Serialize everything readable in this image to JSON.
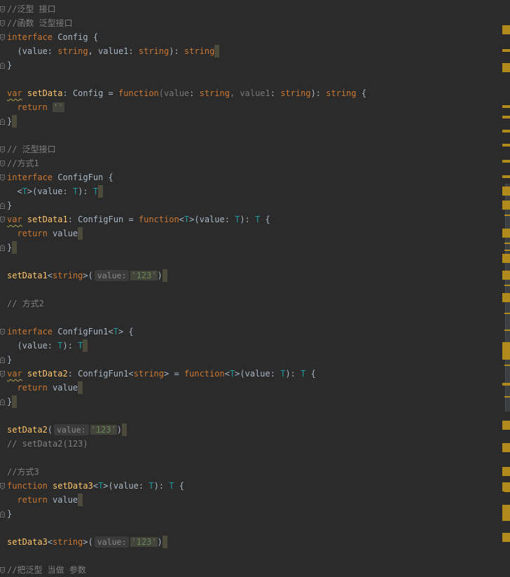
{
  "colors": {
    "background": "#2b2b2b",
    "comment": "#808080",
    "keyword": "#cc7832",
    "function_name": "#ffc66d",
    "string": "#6a8759",
    "type_param": "#20999d",
    "text": "#a9b7c6",
    "marker": "#b08a1a"
  },
  "lines": [
    {
      "fold": "open",
      "tokens": [
        [
          "c",
          "//泛型 接口"
        ]
      ]
    },
    {
      "fold": "open",
      "tokens": [
        [
          "c",
          "//函数 泛型接口"
        ]
      ]
    },
    {
      "fold": "open",
      "tokens": [
        [
          "k",
          "interface"
        ],
        [
          "p",
          " Config {"
        ]
      ]
    },
    {
      "fold": "",
      "tokens": [
        [
          "p",
          "  (value: "
        ],
        [
          "k",
          "string"
        ],
        [
          "p",
          ", value1: "
        ],
        [
          "k",
          "string"
        ],
        [
          "p",
          "): "
        ],
        [
          "k",
          "string"
        ],
        [
          "caret",
          ""
        ]
      ]
    },
    {
      "fold": "close",
      "tokens": [
        [
          "p",
          "}"
        ]
      ]
    },
    {
      "fold": "",
      "tokens": []
    },
    {
      "fold": "",
      "tokens": [
        [
          "ksq",
          "var"
        ],
        [
          "p",
          " "
        ],
        [
          "f",
          "setData"
        ],
        [
          "p",
          ": Config = "
        ],
        [
          "k",
          "function"
        ],
        [
          "d",
          "("
        ],
        [
          "d",
          "value"
        ],
        [
          "p",
          ": "
        ],
        [
          "k",
          "string"
        ],
        [
          "d",
          ", value1"
        ],
        [
          "p",
          ": "
        ],
        [
          "k",
          "string"
        ],
        [
          "p",
          "): "
        ],
        [
          "k",
          "string"
        ],
        [
          "p",
          " {"
        ]
      ]
    },
    {
      "fold": "",
      "tokens": [
        [
          "p",
          "  "
        ],
        [
          "k",
          "return"
        ],
        [
          "p",
          " "
        ],
        [
          "shl",
          "''"
        ]
      ]
    },
    {
      "fold": "close",
      "tokens": [
        [
          "p",
          "}"
        ],
        [
          "caret",
          ""
        ]
      ]
    },
    {
      "fold": "",
      "tokens": []
    },
    {
      "fold": "open",
      "tokens": [
        [
          "c",
          "// 泛型接口"
        ]
      ]
    },
    {
      "fold": "open",
      "tokens": [
        [
          "c",
          "//方式1"
        ]
      ]
    },
    {
      "fold": "open",
      "tokens": [
        [
          "k",
          "interface"
        ],
        [
          "p",
          " ConfigFun {"
        ]
      ]
    },
    {
      "fold": "",
      "tokens": [
        [
          "p",
          "  <"
        ],
        [
          "t",
          "T"
        ],
        [
          "p",
          ">(value: "
        ],
        [
          "t",
          "T"
        ],
        [
          "p",
          "): "
        ],
        [
          "t",
          "T"
        ],
        [
          "caret",
          ""
        ]
      ]
    },
    {
      "fold": "close",
      "tokens": [
        [
          "p",
          "}"
        ]
      ]
    },
    {
      "fold": "open",
      "tokens": [
        [
          "ksq",
          "var"
        ],
        [
          "p",
          " "
        ],
        [
          "f",
          "setData1"
        ],
        [
          "p",
          ": ConfigFun = "
        ],
        [
          "k",
          "function"
        ],
        [
          "p",
          "<"
        ],
        [
          "t",
          "T"
        ],
        [
          "p",
          ">(value: "
        ],
        [
          "t",
          "T"
        ],
        [
          "p",
          "): "
        ],
        [
          "t",
          "T"
        ],
        [
          "p",
          " {"
        ]
      ]
    },
    {
      "fold": "",
      "tokens": [
        [
          "p",
          "  "
        ],
        [
          "k",
          "return"
        ],
        [
          "p",
          " value"
        ],
        [
          "caret",
          ""
        ]
      ]
    },
    {
      "fold": "close",
      "tokens": [
        [
          "p",
          "}"
        ],
        [
          "caret",
          ""
        ]
      ]
    },
    {
      "fold": "",
      "tokens": []
    },
    {
      "fold": "",
      "tokens": [
        [
          "f",
          "setData1"
        ],
        [
          "p",
          "<"
        ],
        [
          "k",
          "string"
        ],
        [
          "p",
          ">("
        ],
        [
          "hint",
          "value:"
        ],
        [
          "shl",
          "'123'"
        ],
        [
          "p",
          ")"
        ],
        [
          "caret",
          ""
        ]
      ]
    },
    {
      "fold": "",
      "tokens": []
    },
    {
      "fold": "",
      "tokens": [
        [
          "c",
          "// 方式2"
        ]
      ]
    },
    {
      "fold": "",
      "tokens": []
    },
    {
      "fold": "open",
      "tokens": [
        [
          "k",
          "interface"
        ],
        [
          "p",
          " ConfigFun1<"
        ],
        [
          "t",
          "T"
        ],
        [
          "p",
          "> {"
        ]
      ]
    },
    {
      "fold": "",
      "tokens": [
        [
          "p",
          "  (value: "
        ],
        [
          "t",
          "T"
        ],
        [
          "p",
          "): "
        ],
        [
          "t",
          "T"
        ],
        [
          "caret",
          ""
        ]
      ]
    },
    {
      "fold": "close",
      "tokens": [
        [
          "p",
          "}"
        ]
      ]
    },
    {
      "fold": "open",
      "tokens": [
        [
          "ksq",
          "var"
        ],
        [
          "p",
          " "
        ],
        [
          "f",
          "setData2"
        ],
        [
          "p",
          ": ConfigFun1<"
        ],
        [
          "k",
          "string"
        ],
        [
          "p",
          "> = "
        ],
        [
          "k",
          "function"
        ],
        [
          "p",
          "<"
        ],
        [
          "t",
          "T"
        ],
        [
          "p",
          ">(value: "
        ],
        [
          "t",
          "T"
        ],
        [
          "p",
          "): "
        ],
        [
          "t",
          "T"
        ],
        [
          "p",
          " {"
        ]
      ]
    },
    {
      "fold": "",
      "tokens": [
        [
          "p",
          "  "
        ],
        [
          "k",
          "return"
        ],
        [
          "p",
          " value"
        ],
        [
          "caret",
          ""
        ]
      ]
    },
    {
      "fold": "close",
      "tokens": [
        [
          "p",
          "}"
        ],
        [
          "caret",
          ""
        ]
      ]
    },
    {
      "fold": "",
      "tokens": []
    },
    {
      "fold": "",
      "tokens": [
        [
          "f",
          "setData2"
        ],
        [
          "p",
          "("
        ],
        [
          "hint",
          "value:"
        ],
        [
          "shl",
          "'123'"
        ],
        [
          "p",
          ")"
        ],
        [
          "caret",
          ""
        ]
      ]
    },
    {
      "fold": "",
      "tokens": [
        [
          "c",
          "// setData2(123)"
        ]
      ]
    },
    {
      "fold": "",
      "tokens": []
    },
    {
      "fold": "",
      "tokens": [
        [
          "c",
          "//方式3"
        ]
      ]
    },
    {
      "fold": "open",
      "tokens": [
        [
          "k",
          "function"
        ],
        [
          "p",
          " "
        ],
        [
          "f",
          "setData3"
        ],
        [
          "p",
          "<"
        ],
        [
          "t",
          "T"
        ],
        [
          "p",
          ">(value: "
        ],
        [
          "t",
          "T"
        ],
        [
          "p",
          "): "
        ],
        [
          "t",
          "T"
        ],
        [
          "p",
          " {"
        ]
      ]
    },
    {
      "fold": "",
      "tokens": [
        [
          "p",
          "  "
        ],
        [
          "k",
          "return"
        ],
        [
          "p",
          " value"
        ],
        [
          "caret",
          ""
        ]
      ]
    },
    {
      "fold": "close",
      "tokens": [
        [
          "p",
          "}"
        ]
      ]
    },
    {
      "fold": "",
      "tokens": []
    },
    {
      "fold": "",
      "tokens": [
        [
          "f",
          "setData3"
        ],
        [
          "p",
          "<"
        ],
        [
          "k",
          "string"
        ],
        [
          "p",
          ">("
        ],
        [
          "hint",
          "value:"
        ],
        [
          "shl",
          "'123'"
        ],
        [
          "p",
          ")"
        ],
        [
          "caret",
          ""
        ]
      ]
    },
    {
      "fold": "",
      "tokens": []
    },
    {
      "fold": "open",
      "tokens": [
        [
          "c",
          "//把泛型 当做 参数"
        ]
      ]
    }
  ]
}
